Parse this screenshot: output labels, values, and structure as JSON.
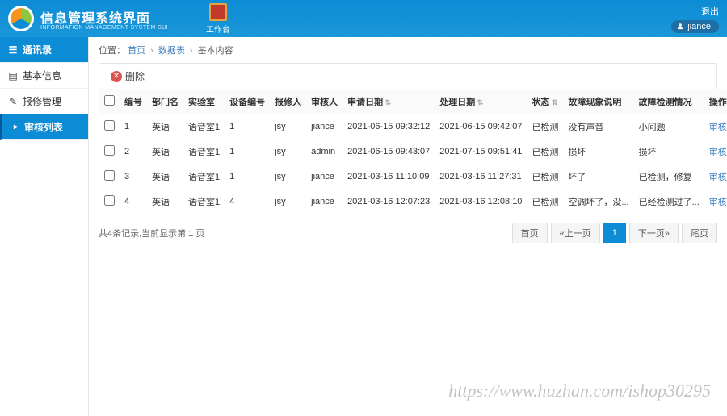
{
  "header": {
    "app_title": "信息管理系统界面",
    "app_sub": "INFORMATION MANAGEMENT SYSTEM SUI",
    "topnav": {
      "workbench": "工作台"
    },
    "logout": "退出",
    "username": "jiance"
  },
  "sidebar": {
    "items": [
      {
        "label": "通讯录",
        "icon": "book-icon"
      },
      {
        "label": "基本信息",
        "icon": "doc-icon"
      },
      {
        "label": "报修管理",
        "icon": "edit-icon"
      },
      {
        "label": "审核列表",
        "icon": "list-icon",
        "active": true
      }
    ]
  },
  "breadcrumb": {
    "prefix": "位置：",
    "parts": [
      "首页",
      "数据表",
      "基本内容"
    ]
  },
  "toolbar": {
    "delete": "删除"
  },
  "table": {
    "headers": {
      "num": "编号",
      "dept": "部门名",
      "lab": "实验室",
      "device": "设备编号",
      "reporter": "报修人",
      "auditor": "审核人",
      "apply_date": "申请日期",
      "handle_date": "处理日期",
      "status": "状态",
      "desc": "故障现象说明",
      "result": "故障检测情况",
      "ops": "操作"
    },
    "rows": [
      {
        "num": "1",
        "dept": "英语",
        "lab": "语音室1",
        "device": "1",
        "reporter": "jsy",
        "auditor": "jiance",
        "apply": "2021-06-15 09:32:12",
        "handle": "2021-06-15 09:42:07",
        "status": "已检测",
        "desc": "没有声音",
        "result": "小问题",
        "op": "审核"
      },
      {
        "num": "2",
        "dept": "英语",
        "lab": "语音室1",
        "device": "1",
        "reporter": "jsy",
        "auditor": "admin",
        "apply": "2021-06-15 09:43:07",
        "handle": "2021-07-15 09:51:41",
        "status": "已检测",
        "desc": "损坏",
        "result": "损坏",
        "op": "审核"
      },
      {
        "num": "3",
        "dept": "英语",
        "lab": "语音室1",
        "device": "1",
        "reporter": "jsy",
        "auditor": "jiance",
        "apply": "2021-03-16 11:10:09",
        "handle": "2021-03-16 11:27:31",
        "status": "已检测",
        "desc": "坏了",
        "result": "已检测，修复",
        "op": "审核"
      },
      {
        "num": "4",
        "dept": "英语",
        "lab": "语音室1",
        "device": "4",
        "reporter": "jsy",
        "auditor": "jiance",
        "apply": "2021-03-16 12:07:23",
        "handle": "2021-03-16 12:08:10",
        "status": "已检测",
        "desc": "空调坏了，没...",
        "result": "已经检测过了...",
        "op": "审核"
      }
    ]
  },
  "pager": {
    "summary": "共4条记录,当前显示第 1 页",
    "first": "首页",
    "prev": "«上一页",
    "page1": "1",
    "next": "下一页»",
    "last": "尾页"
  },
  "watermark": "https://www.huzhan.com/ishop30295"
}
